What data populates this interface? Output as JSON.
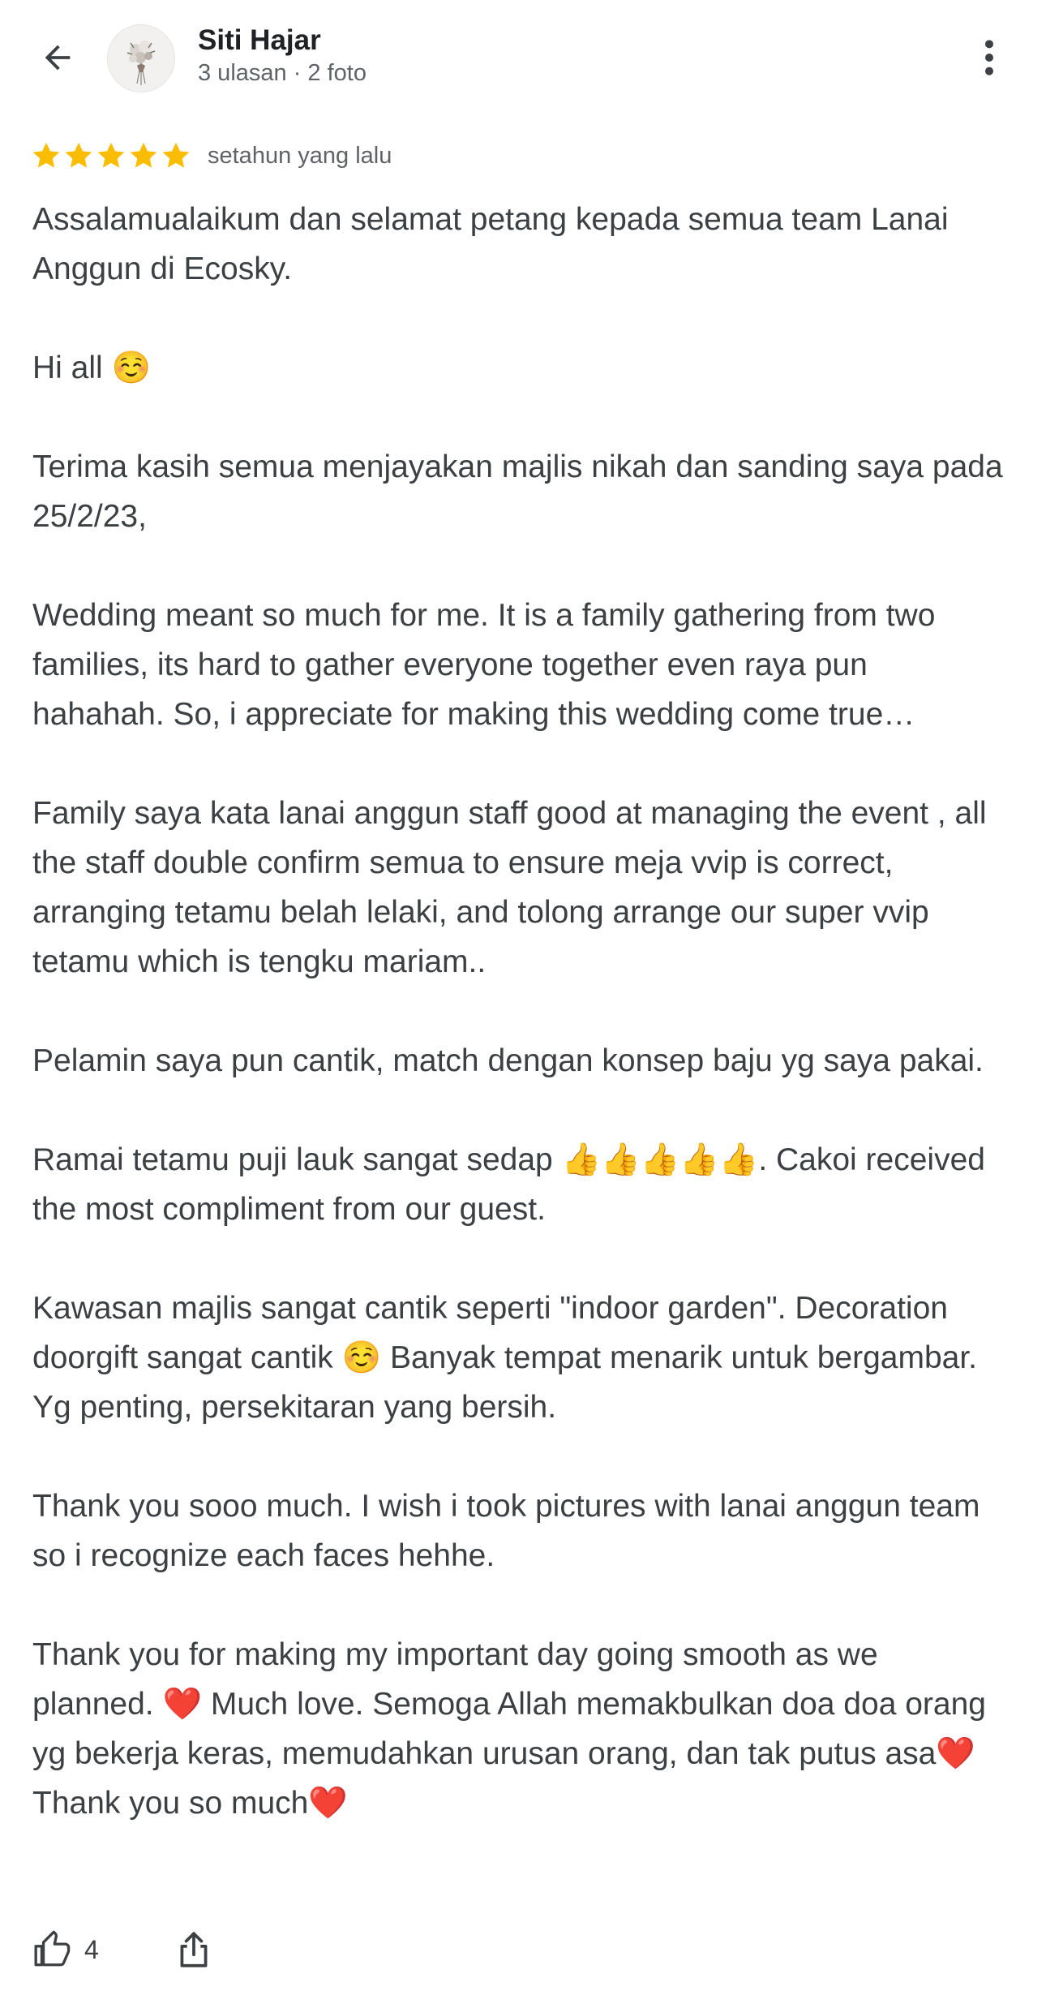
{
  "header": {
    "user_name": "Siti Hajar",
    "user_meta": "3 ulasan · 2 foto",
    "back_icon": "arrow-left-icon",
    "more_icon": "more-vertical-icon"
  },
  "review": {
    "rating": 5,
    "rating_max": 5,
    "star_color": "#fbbc04",
    "date": "setahun yang lalu",
    "paragraphs": [
      "Assalamualaikum dan selamat petang kepada semua team Lanai Anggun di Ecosky.",
      "Hi all ☺️",
      "Terima kasih semua menjayakan majlis nikah dan sanding saya pada 25/2/23,",
      "Wedding meant so much for me. It is a family gathering from two families, its hard to gather everyone together even raya pun hahahah. So, i appreciate for making this wedding come true…",
      "Family saya kata lanai anggun staff good at managing the event , all the staff double confirm semua to ensure meja vvip is correct, arranging tetamu belah lelaki, and tolong arrange our super vvip tetamu which is tengku mariam..",
      "Pelamin saya pun cantik, match dengan konsep baju yg saya pakai.",
      "Ramai tetamu puji lauk sangat sedap 👍👍👍👍👍. Cakoi received the most compliment from our guest.",
      "Kawasan majlis sangat cantik seperti \"indoor garden\". Decoration doorgift sangat cantik ☺️ Banyak tempat menarik untuk bergambar. Yg penting, persekitaran yang bersih.",
      "Thank you sooo much. I wish i took pictures with lanai anggun team so i recognize each faces hehhe.",
      "Thank you for making my important day going smooth as we planned. ❤️ Much love. Semoga Allah memakbulkan doa doa orang yg bekerja keras, memudahkan urusan orang, dan tak putus asa❤️ Thank you so much❤️"
    ]
  },
  "actions": {
    "like_count": "4",
    "like_icon": "thumbs-up-icon",
    "share_icon": "share-icon"
  },
  "colors": {
    "text_primary": "#202124",
    "text_body": "#3c4043",
    "text_secondary": "#5f6368",
    "star": "#fbbc04"
  }
}
